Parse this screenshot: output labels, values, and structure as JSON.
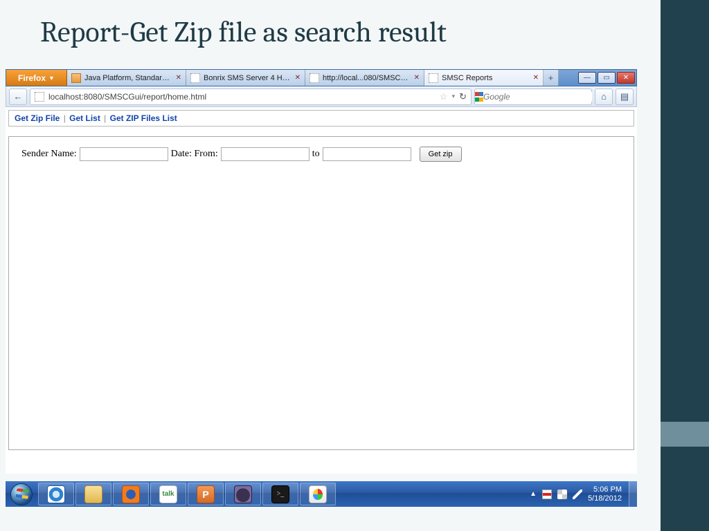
{
  "slide": {
    "title": "Report-Get Zip file as search result"
  },
  "browser": {
    "app_button": "Firefox",
    "tabs": [
      {
        "label": "Java Platform, Standard Ed..."
      },
      {
        "label": "Bonrix SMS Server 4 HTTP ..."
      },
      {
        "label": "http://local...080/SMSCGui/"
      },
      {
        "label": "SMSC Reports"
      }
    ],
    "url": "localhost:8080/SMSCGui/report/home.html",
    "search_placeholder": "Google"
  },
  "page": {
    "breadcrumb": [
      {
        "label": "Get Zip File"
      },
      {
        "label": "Get List"
      },
      {
        "label": "Get ZIP Files List"
      }
    ],
    "sep": "|",
    "form": {
      "sender_label": "Sender Name:",
      "date_from_label": "Date: From:",
      "to_label": "to",
      "button": "Get zip"
    }
  },
  "taskbar": {
    "talk_text": "talk",
    "ppt_text": "P",
    "cmd_text": ">_",
    "time": "5:06 PM",
    "date": "5/18/2012"
  }
}
